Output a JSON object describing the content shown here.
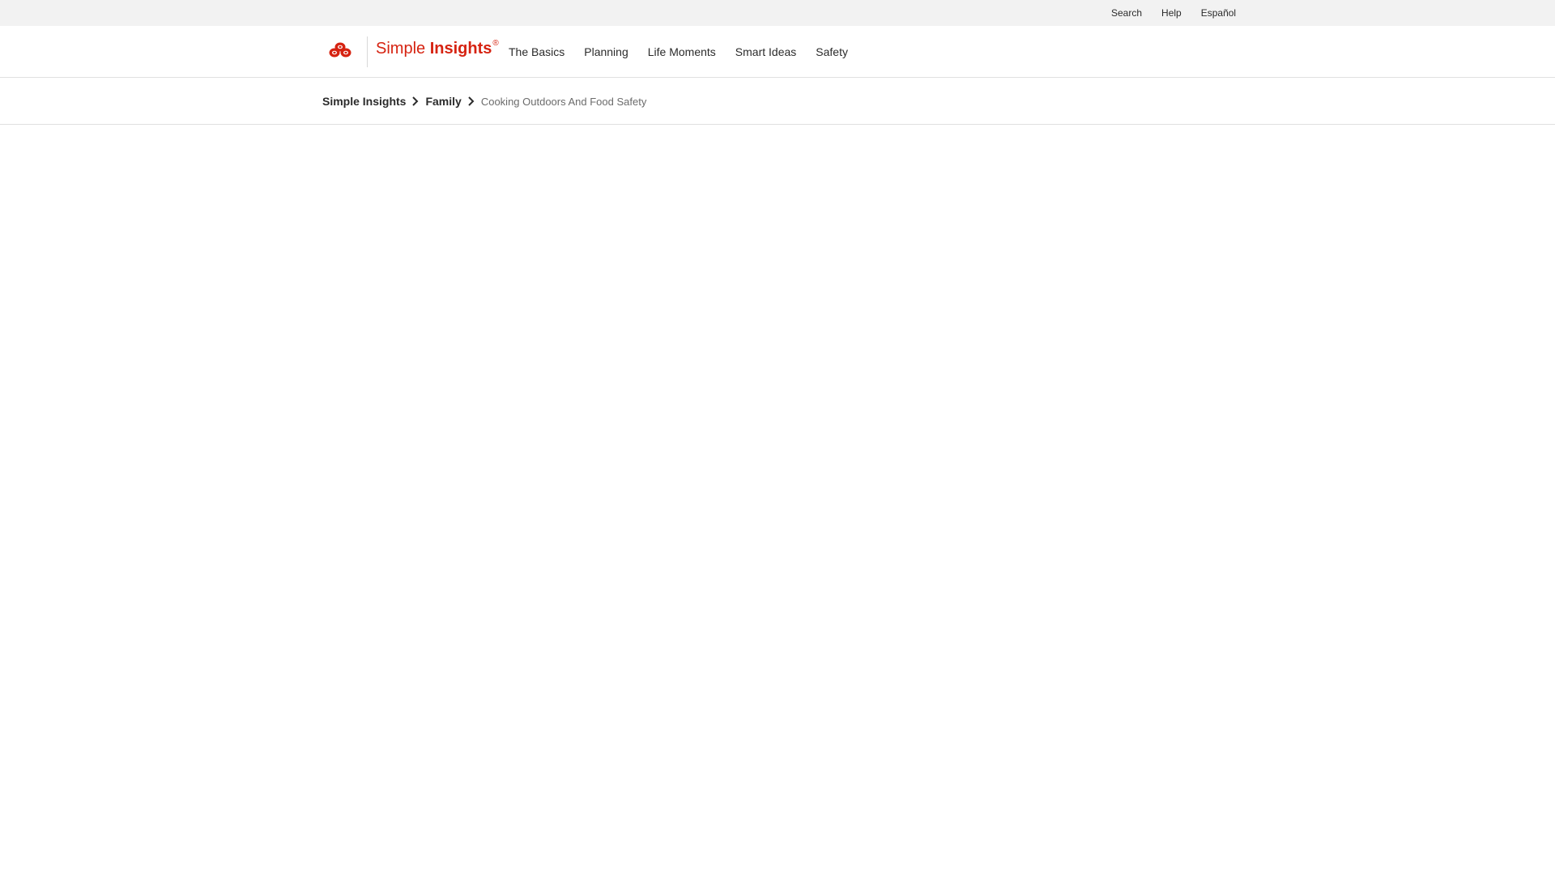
{
  "utility_nav": {
    "search": "Search",
    "help": "Help",
    "language": "Español"
  },
  "header": {
    "brand_part1": "Simple",
    "brand_part2": "Insights",
    "brand_reg": "®",
    "brand_color": "#d62311",
    "logo_icon": "three-ovals-logo-icon"
  },
  "main_nav": {
    "items": [
      "The Basics",
      "Planning",
      "Life Moments",
      "Smart Ideas",
      "Safety"
    ]
  },
  "breadcrumb": {
    "level1": "Simple Insights",
    "level2": "Family",
    "current": "Cooking Outdoors And Food Safety",
    "separator_icon": "chevron-right-icon"
  }
}
